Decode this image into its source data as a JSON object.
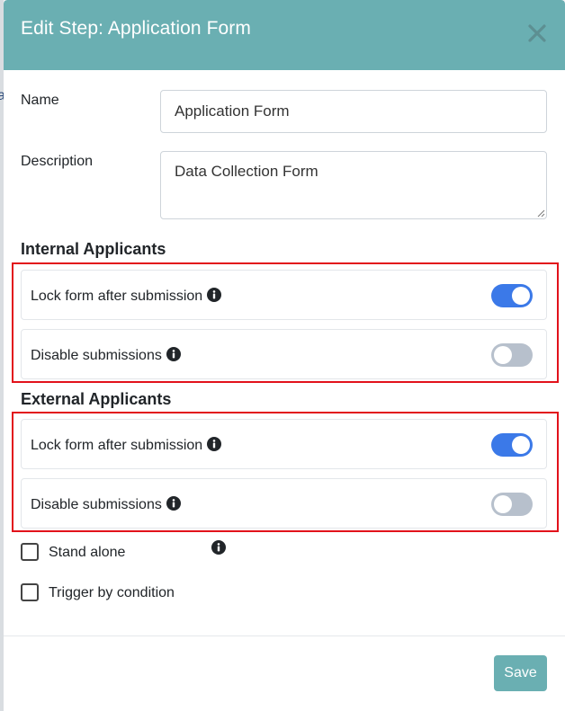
{
  "modal": {
    "title": "Edit Step: Application Form",
    "close_icon": "close-icon"
  },
  "backdrop": {
    "partial_text": "a"
  },
  "form": {
    "name_label": "Name",
    "name_value": "Application Form",
    "description_label": "Description",
    "description_value": "Data Collection Form"
  },
  "internal": {
    "heading": "Internal Applicants",
    "settings": [
      {
        "label": "Lock form after submission",
        "enabled": true
      },
      {
        "label": "Disable submissions",
        "enabled": false
      }
    ]
  },
  "external": {
    "heading": "External Applicants",
    "settings": [
      {
        "label": "Lock form after submission",
        "enabled": true
      },
      {
        "label": "Disable submissions",
        "enabled": false
      }
    ]
  },
  "options": {
    "stand_alone_label": "Stand alone",
    "stand_alone_checked": false,
    "trigger_label": "Trigger by condition",
    "trigger_checked": false
  },
  "footer": {
    "save_label": "Save"
  },
  "colors": {
    "header": "#6aafb2",
    "toggle_on": "#3b79e8",
    "toggle_off": "#b7c0cc",
    "highlight_border": "#e2121b"
  }
}
